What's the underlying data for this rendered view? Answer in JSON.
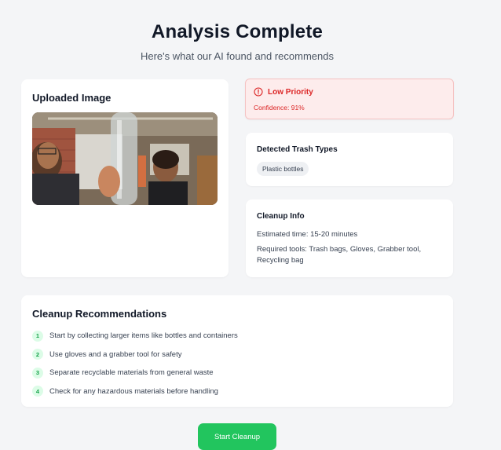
{
  "header": {
    "title": "Analysis Complete",
    "subtitle": "Here's what our AI found and recommends"
  },
  "upload": {
    "title": "Uploaded Image"
  },
  "priority": {
    "label": "Low Priority",
    "confidence": "Confidence: 91%",
    "icon": "alert-circle-icon",
    "color": "#dc2626"
  },
  "trash_types": {
    "title": "Detected Trash Types",
    "tags": [
      "Plastic bottles"
    ]
  },
  "cleanup_info": {
    "title": "Cleanup Info",
    "estimated_time": "Estimated time: 15-20 minutes",
    "required_tools": "Required tools: Trash bags, Gloves, Grabber tool, Recycling bag"
  },
  "recommendations": {
    "title": "Cleanup Recommendations",
    "items": [
      {
        "num": "1",
        "text": "Start by collecting larger items like bottles and containers"
      },
      {
        "num": "2",
        "text": "Use gloves and a grabber tool for safety"
      },
      {
        "num": "3",
        "text": "Separate recyclable materials from general waste"
      },
      {
        "num": "4",
        "text": "Check for any hazardous materials before handling"
      }
    ]
  },
  "actions": {
    "start_label": "Start Cleanup"
  },
  "colors": {
    "accent": "#22c55e",
    "alert_bg": "#fdecec",
    "page_bg": "#f4f5f7"
  }
}
